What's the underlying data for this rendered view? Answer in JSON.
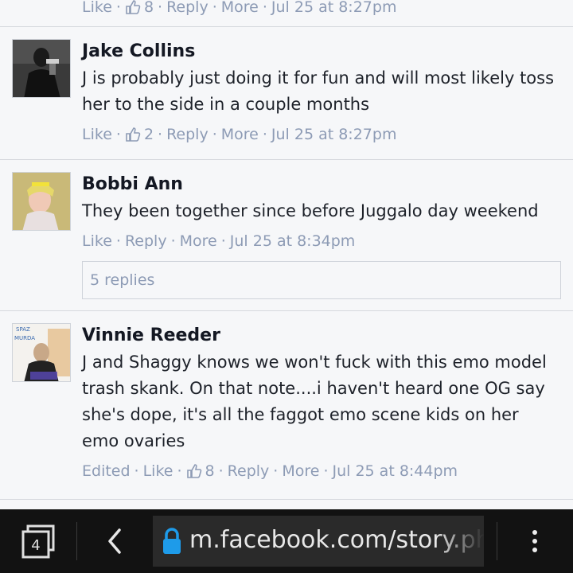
{
  "top_partial": {
    "like": "Like",
    "like_count": "8",
    "reply": "Reply",
    "more": "More",
    "time": "Jul 25 at 8:27pm"
  },
  "comments": [
    {
      "author": "Jake Collins",
      "text": "J is probably just doing it for fun and will most likely toss her to the side in a couple months",
      "like": "Like",
      "like_count": "2",
      "reply": "Reply",
      "more": "More",
      "time": "Jul 25 at 8:27pm"
    },
    {
      "author": "Bobbi Ann",
      "text": "They been together since before Juggalo day weekend",
      "like": "Like",
      "reply": "Reply",
      "more": "More",
      "time": "Jul 25 at 8:34pm",
      "replies": "5 replies"
    },
    {
      "author": "Vinnie Reeder",
      "text": "J and Shaggy knows we won't fuck with this emo model trash skank. On that note....i haven't heard one OG say she's dope, it's all the faggot emo scene kids on her emo ovaries",
      "edited": "Edited",
      "like": "Like",
      "like_count": "8",
      "reply": "Reply",
      "more": "More",
      "time": "Jul 25 at 8:44pm",
      "avatar_text_1": "SPAZ",
      "avatar_text_2": "MURDA"
    }
  ],
  "browser": {
    "tab_count": "4",
    "url": "m.facebook.com/story.ph"
  },
  "icons": {
    "tabs": "tabs-icon",
    "back": "back-arrow-icon",
    "lock": "lock-icon",
    "menu": "overflow-menu-icon",
    "like": "thumbs-up-icon"
  },
  "colors": {
    "meta_link": "#8d9bb5",
    "lock": "#1e9be9",
    "bar": "#121212"
  }
}
